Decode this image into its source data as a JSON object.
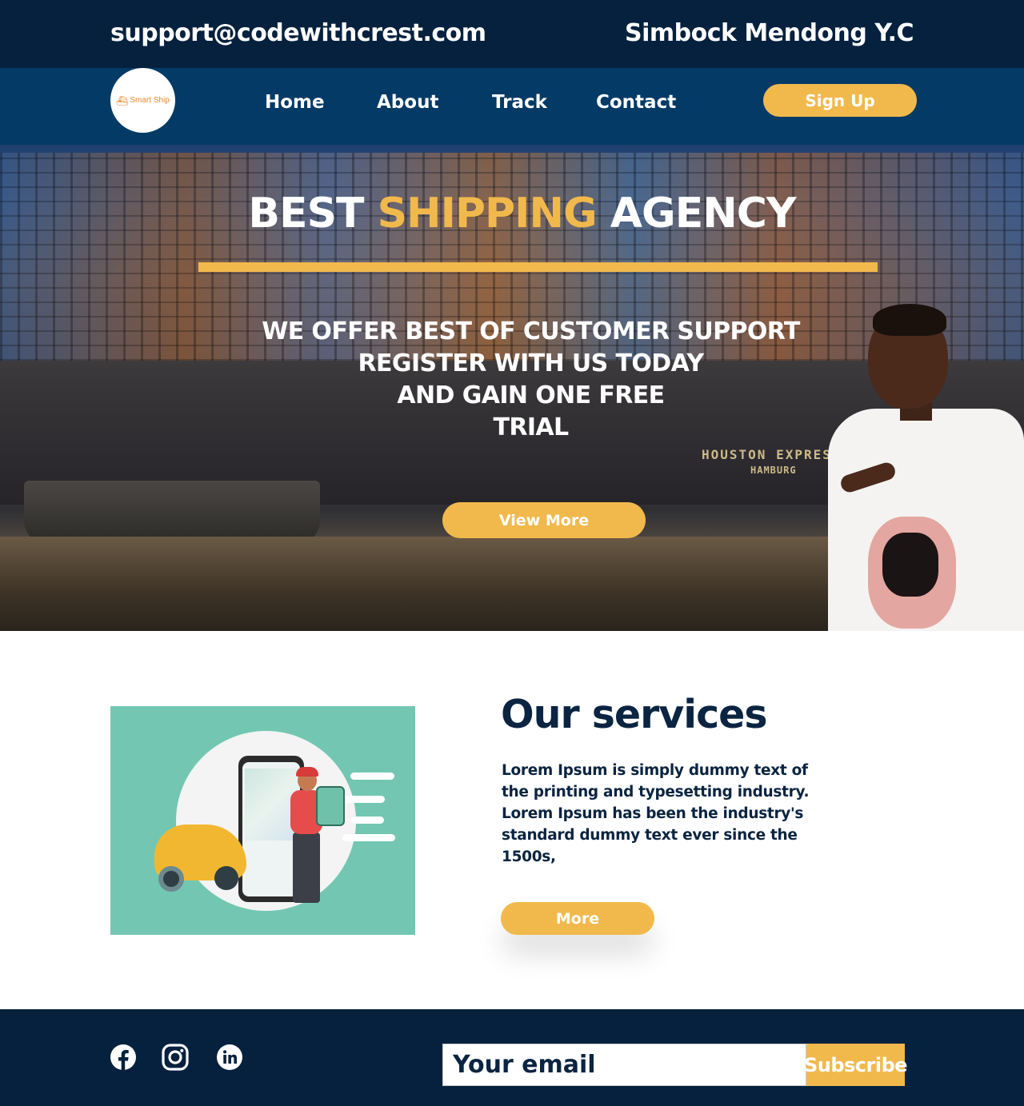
{
  "topbar": {
    "email": "support@codewithcrest.com",
    "owner": "Simbock Mendong Y.C"
  },
  "nav": {
    "logo_text": "Smart Ship",
    "links": [
      "Home",
      "About",
      "Track",
      "Contact"
    ],
    "signup_label": "Sign Up"
  },
  "hero": {
    "title_part1": "BEST",
    "title_accent": "SHIPPING",
    "title_part2": "AGENCY",
    "subtitle_lines": [
      "WE OFFER BEST OF CUSTOMER SUPPORT",
      "REGISTER WITH US TODAY",
      "AND GAIN ONE FREE",
      "TRIAL"
    ],
    "view_more_label": "View More",
    "ship_text_1": "HOUSTON EXPRES",
    "ship_text_2": "HAMBURG"
  },
  "services": {
    "title": "Our services",
    "body": "Lorem Ipsum is simply dummy text of the printing and typesetting industry. Lorem Ipsum has been the industry's standard dummy text ever since the 1500s,",
    "more_label": "More"
  },
  "footer": {
    "social_icons": [
      "facebook-icon",
      "instagram-icon",
      "linkedin-icon"
    ],
    "email_placeholder": "Your email",
    "subscribe_label": "Subscribe"
  },
  "colors": {
    "topbar_bg": "#05213e",
    "navbar_bg": "#033a66",
    "accent": "#f1b94c",
    "heading": "#0a2441",
    "illustration_bg": "#73c7b2"
  }
}
